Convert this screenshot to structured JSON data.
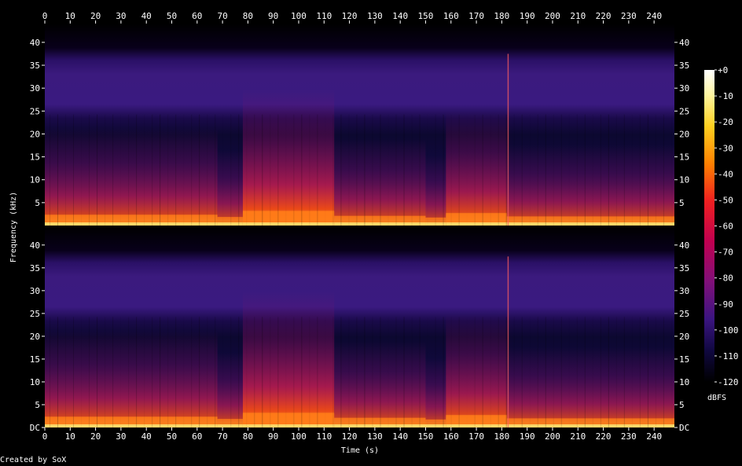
{
  "chart_data": {
    "type": "heatmap",
    "title": "",
    "xlabel": "Time (s)",
    "ylabel": "Frequency (kHz)",
    "xlim": [
      0,
      248
    ],
    "ylim": [
      0,
      44.1
    ],
    "x_ticks": [
      "0",
      "10",
      "20",
      "30",
      "40",
      "50",
      "60",
      "70",
      "80",
      "90",
      "100",
      "110",
      "120",
      "130",
      "140",
      "150",
      "160",
      "170",
      "180",
      "190",
      "200",
      "210",
      "220",
      "230",
      "240"
    ],
    "y_ticks": [
      "5",
      "10",
      "15",
      "20",
      "25",
      "30",
      "35",
      "40"
    ],
    "y_ticks_bottom_channel": [
      "DC",
      "5",
      "10",
      "15",
      "20",
      "25",
      "30",
      "35",
      "40"
    ],
    "channels": 2,
    "colorbar": {
      "label": "dBFS",
      "ticks": [
        "+0",
        "-10",
        "-20",
        "-30",
        "-40",
        "-50",
        "-60",
        "-70",
        "-80",
        "-90",
        "-100",
        "-110",
        "-120"
      ],
      "range": [
        -120,
        0
      ]
    },
    "segments": [
      {
        "t0": 0,
        "t1": 68,
        "energy": 0.55
      },
      {
        "t0": 68,
        "t1": 78,
        "energy": 0.35
      },
      {
        "t0": 78,
        "t1": 114,
        "energy": 0.9
      },
      {
        "t0": 114,
        "t1": 150,
        "energy": 0.45
      },
      {
        "t0": 150,
        "t1": 158,
        "energy": 0.3
      },
      {
        "t0": 158,
        "t1": 182,
        "energy": 0.7
      },
      {
        "t0": 182,
        "t1": 248,
        "energy": 0.4
      }
    ],
    "colors": {
      "background": "#000000",
      "floor_band": "#3c1a7a",
      "signal": "#ff3a1a",
      "peak": "#fff0a0"
    }
  },
  "footer": {
    "credit": "Created by SoX"
  }
}
